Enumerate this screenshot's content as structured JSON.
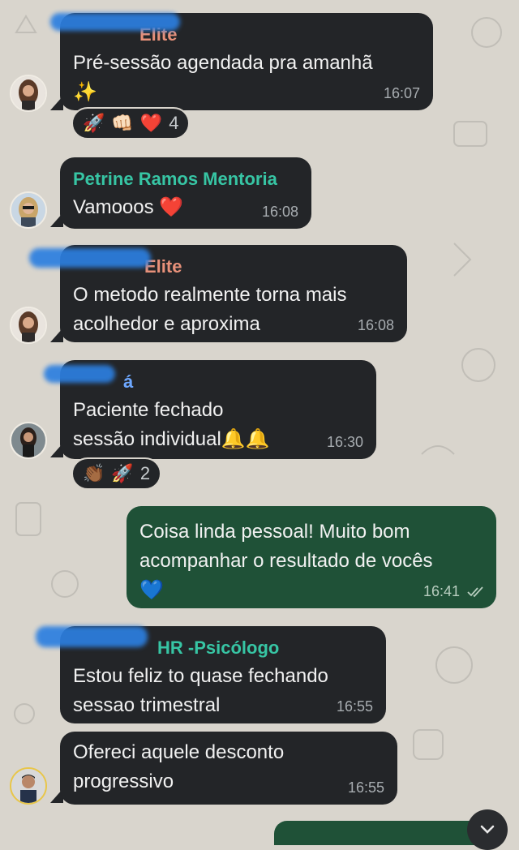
{
  "messages": [
    {
      "sender_visible": "Elite",
      "sender_color": "#e8917a",
      "text": "Pré-sessão agendada pra amanhã\n✨",
      "time": "16:07",
      "reactions": {
        "emojis": [
          "🚀",
          "👊🏻",
          "❤️"
        ],
        "count": "4"
      }
    },
    {
      "sender_visible": "Petrine Ramos Mentoria",
      "sender_color": "#37c5a4",
      "text": "Vamooos ❤️",
      "time": "16:08"
    },
    {
      "sender_visible": "Elite",
      "sender_color": "#e8917a",
      "text": "O metodo realmente torna mais\nacolhedor e aproxima",
      "time": "16:08"
    },
    {
      "sender_visible": "á",
      "sender_color": "#6ea8ff",
      "text": "Paciente fechado\nsessão individual🔔🔔",
      "time": "16:30",
      "reactions": {
        "emojis": [
          "👏🏾",
          "🚀"
        ],
        "count": "2"
      }
    },
    {
      "text": "Coisa linda pessoal! Muito bom\nacompanhar o resultado de vocês\n💙",
      "time": "16:41",
      "status": "read"
    },
    {
      "sender_visible": "HR -Psicólogo",
      "sender_color": "#37c5a4",
      "text": "Estou feliz to quase fechando\nsessao trimestral",
      "time": "16:55"
    },
    {
      "text": "Ofereci aquele desconto\nprogressivo",
      "time": "16:55"
    }
  ],
  "colors": {
    "wallpaper": "#d9d5cd",
    "incoming_bubble": "#232528",
    "outgoing_bubble": "#1f5137",
    "redaction": "#2c7fe0"
  },
  "icons": {
    "read_receipt": "double-check-icon",
    "scroll_down": "chevron-down-icon"
  }
}
